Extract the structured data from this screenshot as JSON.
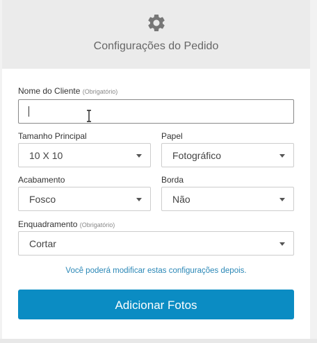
{
  "header": {
    "title": "Configurações do Pedido",
    "icon": "gear-icon"
  },
  "form": {
    "client_name": {
      "label": "Nome do Cliente",
      "required_note": "(Obrigatório)",
      "value": ""
    },
    "main_size": {
      "label": "Tamanho Principal",
      "value": "10 X 10"
    },
    "paper": {
      "label": "Papel",
      "value": "Fotográfico"
    },
    "finish": {
      "label": "Acabamento",
      "value": "Fosco"
    },
    "border": {
      "label": "Borda",
      "value": "Não"
    },
    "framing": {
      "label": "Enquadramento",
      "required_note": "(Obrigatório)",
      "value": "Cortar"
    }
  },
  "hint": "Você poderá modificar estas configurações depois.",
  "actions": {
    "add_photos_label": "Adicionar Fotos"
  },
  "colors": {
    "accent": "#0b8cc3",
    "hint_text": "#2a87b6",
    "header_bg": "#ebebeb"
  }
}
